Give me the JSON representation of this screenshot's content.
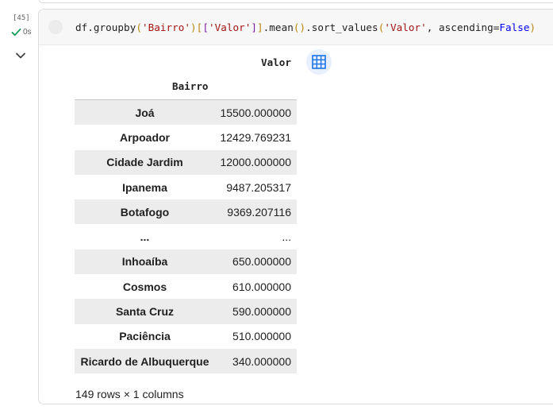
{
  "gutter": {
    "exec_count": "[45]",
    "exec_time": "0s",
    "status_icon": "check-icon",
    "collapse_icon": "chevron-down-icon"
  },
  "code": {
    "tokens": [
      {
        "t": "df.groupby",
        "c": "plain"
      },
      {
        "t": "(",
        "c": "br1"
      },
      {
        "t": "'Bairro'",
        "c": "str"
      },
      {
        "t": ")",
        "c": "br1"
      },
      {
        "t": "[",
        "c": "br1"
      },
      {
        "t": "[",
        "c": "br2"
      },
      {
        "t": "'Valor'",
        "c": "str"
      },
      {
        "t": "]",
        "c": "br2"
      },
      {
        "t": "]",
        "c": "br1"
      },
      {
        "t": ".mean",
        "c": "plain"
      },
      {
        "t": "()",
        "c": "br1"
      },
      {
        "t": ".sort_values",
        "c": "plain"
      },
      {
        "t": "(",
        "c": "br1"
      },
      {
        "t": "'Valor'",
        "c": "str"
      },
      {
        "t": ", ascending=",
        "c": "plain"
      },
      {
        "t": "False",
        "c": "kw"
      },
      {
        "t": ")",
        "c": "br1"
      }
    ]
  },
  "output": {
    "column_header": "Valor",
    "index_header": "Bairro",
    "table_icon": "table-icon",
    "rows": [
      {
        "name": "Joá",
        "value": "15500.000000"
      },
      {
        "name": "Arpoador",
        "value": "12429.769231"
      },
      {
        "name": "Cidade Jardim",
        "value": "12000.000000"
      },
      {
        "name": "Ipanema",
        "value": "9487.205317"
      },
      {
        "name": "Botafogo",
        "value": "9369.207116"
      },
      {
        "name": "...",
        "value": "..."
      },
      {
        "name": "Inhoaíba",
        "value": "650.000000"
      },
      {
        "name": "Cosmos",
        "value": "610.000000"
      },
      {
        "name": "Santa Cruz",
        "value": "590.000000"
      },
      {
        "name": "Paciência",
        "value": "510.000000"
      },
      {
        "name": "Ricardo de Albuquerque",
        "value": "340.000000"
      }
    ],
    "shape_note": "149 rows × 1 columns"
  },
  "colors": {
    "accent": "#1a73e8",
    "success": "#0f9d58",
    "string": "#a31515",
    "keyword": "#0000ff"
  }
}
